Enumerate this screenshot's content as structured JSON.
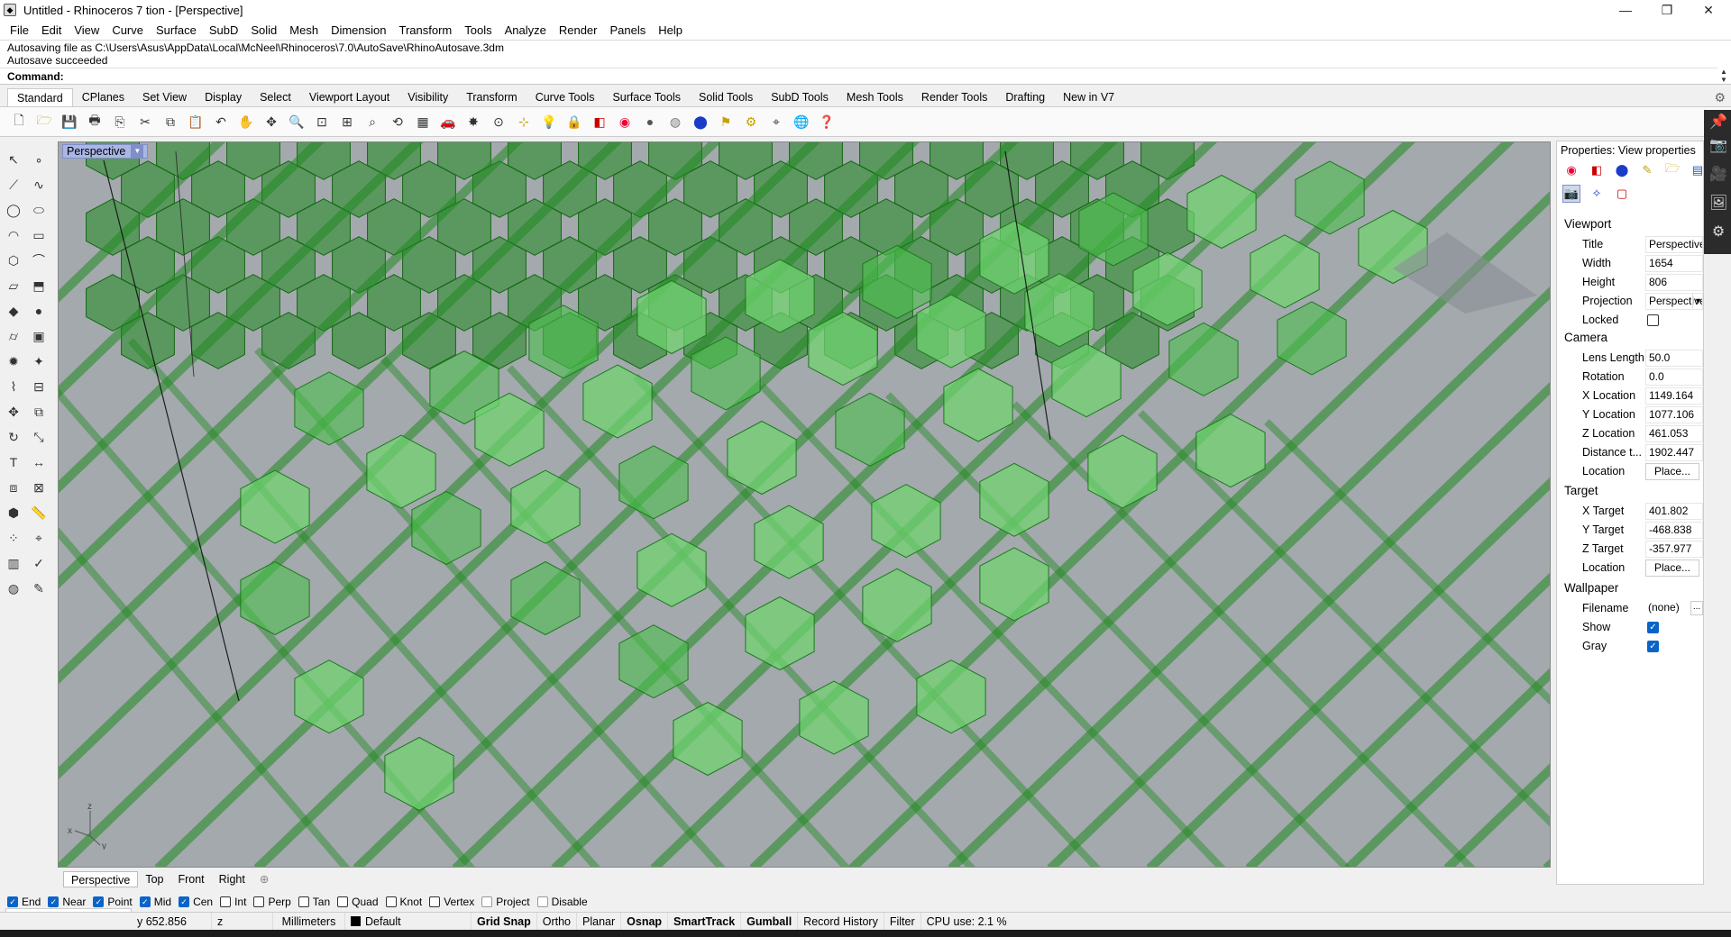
{
  "window": {
    "title": "Untitled - Rhinoceros 7 tion - [Perspective]",
    "minimize": "—",
    "maximize": "❐",
    "close": "✕"
  },
  "menu": [
    "File",
    "Edit",
    "View",
    "Curve",
    "Surface",
    "SubD",
    "Solid",
    "Mesh",
    "Dimension",
    "Transform",
    "Tools",
    "Analyze",
    "Render",
    "Panels",
    "Help"
  ],
  "command": {
    "history1": "Autosaving file as C:\\Users\\Asus\\AppData\\Local\\McNeel\\Rhinoceros\\7.0\\AutoSave\\RhinoAutosave.3dm",
    "history2": "Autosave succeeded",
    "label": "Command:",
    "value": ""
  },
  "toolbar_tabs": [
    "Standard",
    "CPlanes",
    "Set View",
    "Display",
    "Select",
    "Viewport Layout",
    "Visibility",
    "Transform",
    "Curve Tools",
    "Surface Tools",
    "Solid Tools",
    "SubD Tools",
    "Mesh Tools",
    "Render Tools",
    "Drafting",
    "New in V7"
  ],
  "toolbar_icons": [
    "new-file-icon",
    "open-file-icon",
    "save-icon",
    "print-icon",
    "import-icon",
    "cut-icon",
    "copy-icon",
    "paste-icon",
    "undo-icon",
    "pan-hand-icon",
    "rotate-view-icon",
    "zoom-icon",
    "zoom-window-icon",
    "zoom-extents-icon",
    "zoom-selected-icon",
    "zoom-dynamic-icon",
    "four-viewports-icon",
    "car-icon",
    "light-icon",
    "grid-icon",
    "cplane-icon",
    "bulb-icon",
    "lock-icon",
    "layer-icon",
    "color-wheel-icon",
    "shaded-sphere-icon",
    "rendered-sphere-icon",
    "render-icon",
    "lamp-icon",
    "settings-gear-icon",
    "dimension-icon",
    "globe-icon",
    "help-icon"
  ],
  "viewport": {
    "title": "Perspective",
    "tabs": [
      "Perspective",
      "Top",
      "Front",
      "Right"
    ],
    "add_tab": "⊕",
    "axis_x": "x",
    "axis_y": "y",
    "axis_z": "z"
  },
  "properties": {
    "header": "Properties: View properties",
    "sections": {
      "viewport": "Viewport",
      "camera": "Camera",
      "target": "Target",
      "wallpaper": "Wallpaper"
    },
    "title_label": "Title",
    "title_value": "Perspective",
    "width_label": "Width",
    "width_value": "1654",
    "height_label": "Height",
    "height_value": "806",
    "projection_label": "Projection",
    "projection_value": "Perspective",
    "locked_label": "Locked",
    "lens_label": "Lens Length",
    "lens_value": "50.0",
    "rotation_label": "Rotation",
    "rotation_value": "0.0",
    "xloc_label": "X Location",
    "xloc_value": "1149.164",
    "yloc_label": "Y Location",
    "yloc_value": "1077.106",
    "zloc_label": "Z Location",
    "zloc_value": "461.053",
    "dist_label": "Distance t...",
    "dist_value": "1902.447",
    "location_label": "Location",
    "place_button": "Place...",
    "xtarget_label": "X Target",
    "xtarget_value": "401.802",
    "ytarget_label": "Y Target",
    "ytarget_value": "-468.838",
    "ztarget_label": "Z Target",
    "ztarget_value": "-357.977",
    "filename_label": "Filename",
    "filename_value": "(none)",
    "filename_btn": "...",
    "show_label": "Show",
    "gray_label": "Gray"
  },
  "osnaps": [
    {
      "label": "End",
      "on": true
    },
    {
      "label": "Near",
      "on": true
    },
    {
      "label": "Point",
      "on": true
    },
    {
      "label": "Mid",
      "on": true
    },
    {
      "label": "Cen",
      "on": true
    },
    {
      "label": "Int",
      "on": false
    },
    {
      "label": "Perp",
      "on": false
    },
    {
      "label": "Tan",
      "on": false
    },
    {
      "label": "Quad",
      "on": false
    },
    {
      "label": "Knot",
      "on": false
    },
    {
      "label": "Vertex",
      "on": false
    },
    {
      "label": "Project",
      "on": false
    },
    {
      "label": "Disable",
      "on": false
    }
  ],
  "status": {
    "y": "y 652.856",
    "z": "z",
    "units": "Millimeters",
    "layer": "Default",
    "grid_snap": "Grid Snap",
    "ortho": "Ortho",
    "planar": "Planar",
    "osnap": "Osnap",
    "smarttrack": "SmartTrack",
    "gumball": "Gumball",
    "record_history": "Record History",
    "filter": "Filter",
    "cpu": "CPU use: 2.1 %"
  },
  "colors": {
    "viewport_bg": "#a4a9ae",
    "hex_light": "#6fd46f",
    "hex_dark": "#1f8a1f",
    "accent_blue": "#0a64c8"
  }
}
